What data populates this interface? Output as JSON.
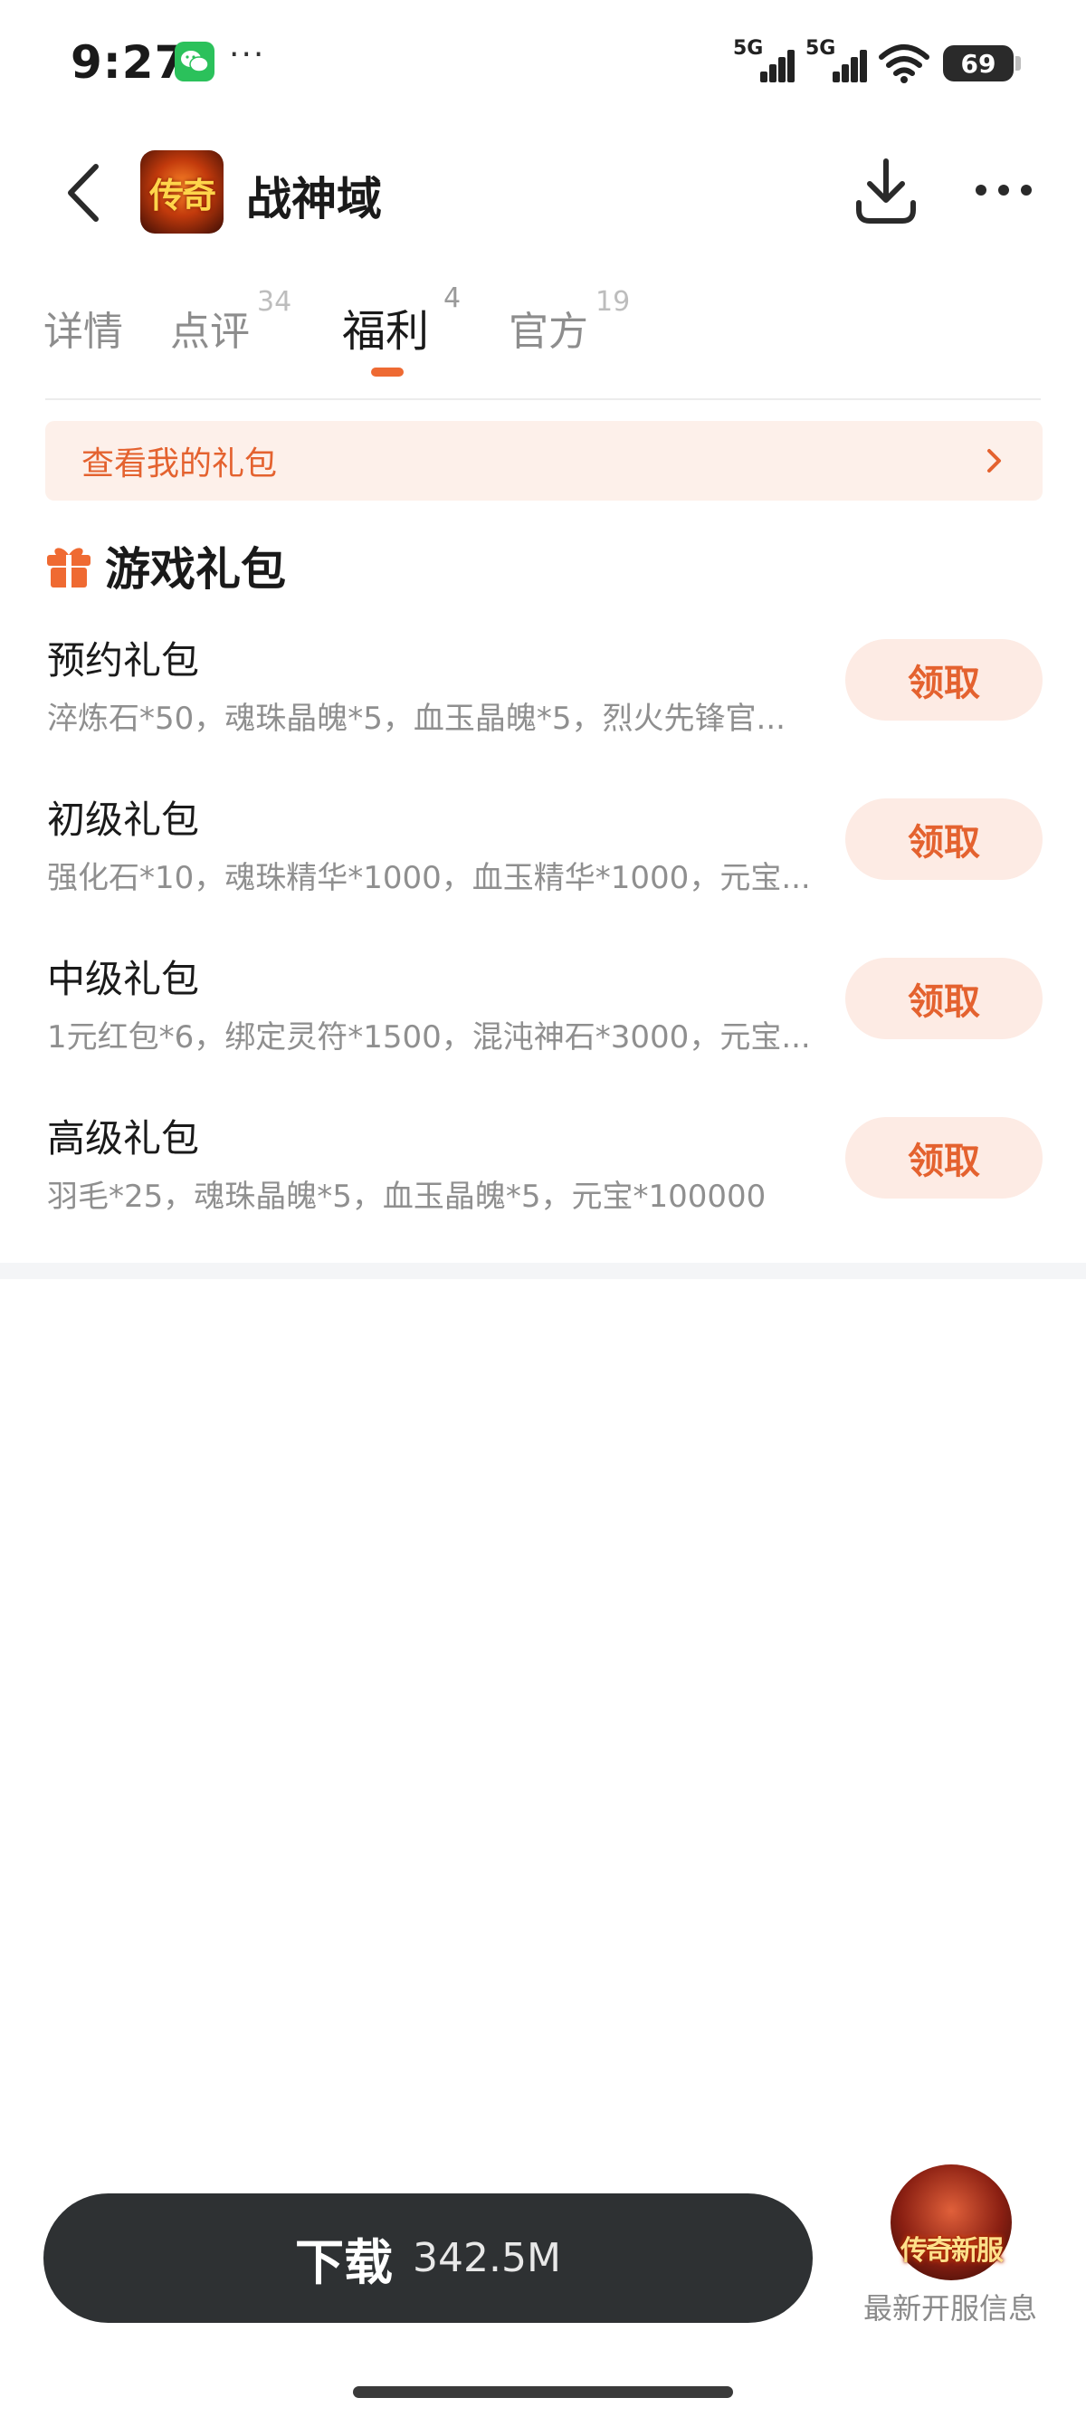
{
  "status_bar": {
    "time": "9:27",
    "network_1": "5G",
    "network_2": "5G",
    "battery": "69",
    "icons": [
      "wechat-icon",
      "more-notifications-icon",
      "signal-icon",
      "wifi-icon",
      "battery-icon"
    ]
  },
  "header": {
    "app_name": "战神域",
    "app_icon_text": "传奇",
    "icons": [
      "back-icon",
      "download-icon",
      "more-icon"
    ]
  },
  "tabs": [
    {
      "label": "详情",
      "count": ""
    },
    {
      "label": "点评",
      "count": "34"
    },
    {
      "label": "福利",
      "count": "4",
      "active": true
    },
    {
      "label": "官方",
      "count": "19"
    }
  ],
  "my_gifts": {
    "label": "查看我的礼包"
  },
  "section": {
    "title": "游戏礼包"
  },
  "gifts": [
    {
      "name": "预约礼包",
      "desc": "淬炼石*50，魂珠晶魄*5，血玉晶魄*5，烈火先锋官...",
      "button": "领取"
    },
    {
      "name": "初级礼包",
      "desc": "强化石*10，魂珠精华*1000，血玉精华*1000，元宝...",
      "button": "领取"
    },
    {
      "name": "中级礼包",
      "desc": "1元红包*6，绑定灵符*1500，混沌神石*3000，元宝...",
      "button": "领取"
    },
    {
      "name": "高级礼包",
      "desc": "羽毛*25，魂珠晶魄*5，血玉晶魄*5，元宝*100000",
      "button": "领取"
    }
  ],
  "bottom": {
    "download_label": "下载",
    "download_size": "342.5M",
    "newserver_badge_text": "传奇新服",
    "newserver_label": "最新开服信息"
  },
  "colors": {
    "accent": "#e4622f",
    "accent_bg": "#fdebe4",
    "banner_bg": "#fdf0ea",
    "download_bg": "#2e3133",
    "indicator": "#ee6a33"
  }
}
